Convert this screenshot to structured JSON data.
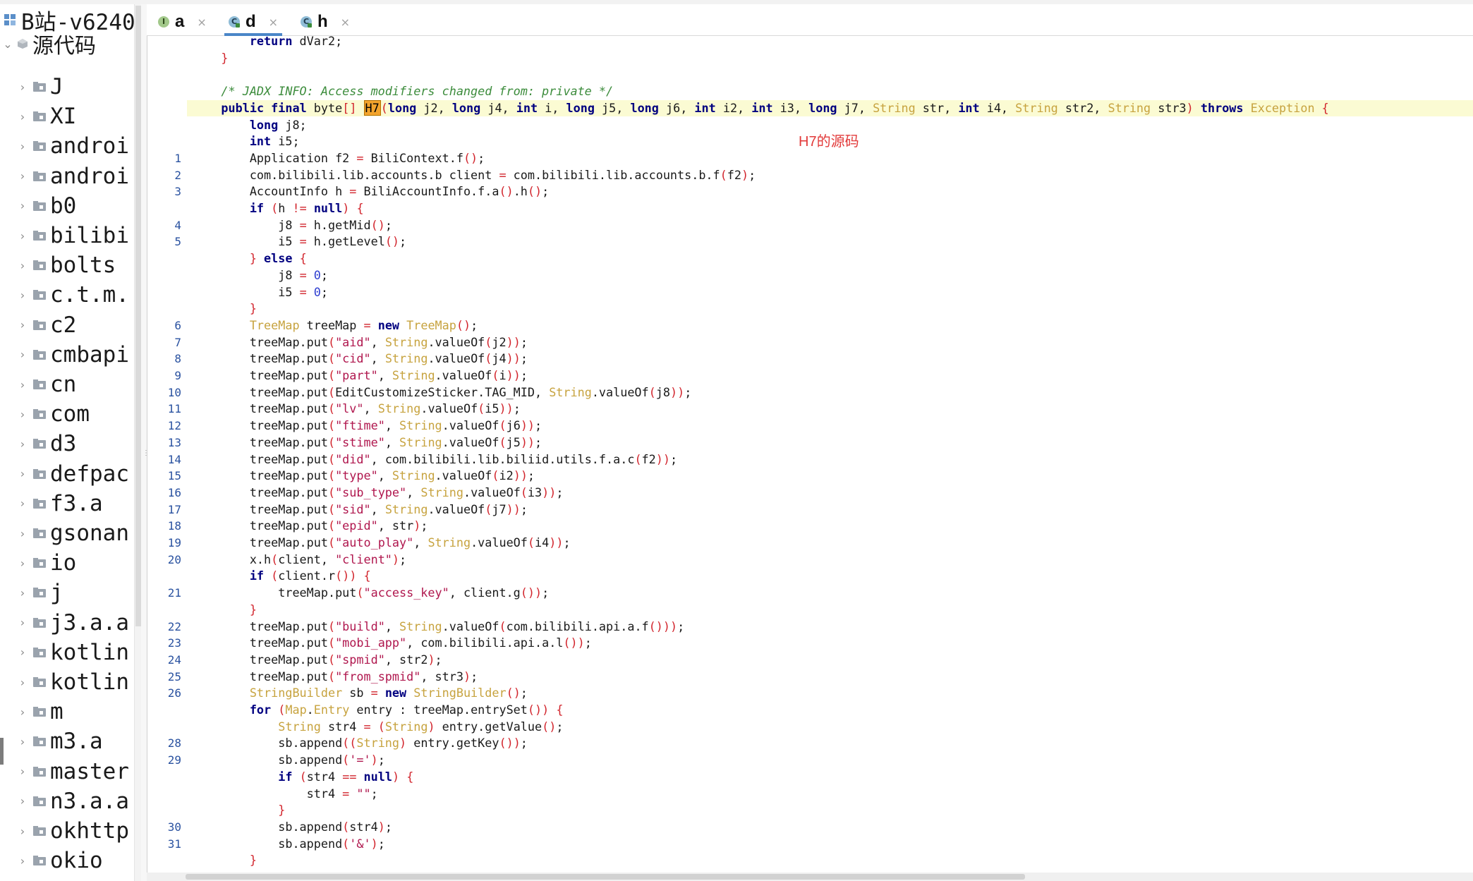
{
  "project": {
    "title": "B站-v6240",
    "root_label": "源代码"
  },
  "tree_items": [
    "J",
    "XI",
    "androi",
    "androi",
    "b0",
    "bilibi",
    "bolts",
    "c.t.m.",
    "c2",
    "cmbapi",
    "cn",
    "com",
    "d3",
    "defpac",
    "f3.a",
    "gsonan",
    "io",
    "j",
    "j3.a.a",
    "kotlin",
    "kotlin",
    "m",
    "m3.a",
    "master",
    "n3.a.a",
    "okhttp",
    "okio"
  ],
  "tabs": [
    {
      "name": "a",
      "icon": "I",
      "kind": "interface",
      "close": "×"
    },
    {
      "name": "d",
      "icon": "C",
      "kind": "class",
      "close": "×",
      "active": true
    },
    {
      "name": "h",
      "icon": "C",
      "kind": "class",
      "close": "×"
    }
  ],
  "annotation": "H7的源码",
  "editor": {
    "line_numbers": [
      "",
      "",
      "",
      "",
      "",
      "",
      "",
      "1",
      "2",
      "3",
      "",
      "4",
      "5",
      "",
      "",
      "",
      "",
      "6",
      "7",
      "8",
      "9",
      "10",
      "11",
      "12",
      "13",
      "14",
      "15",
      "16",
      "17",
      "18",
      "19",
      "20",
      "",
      "21",
      "",
      "22",
      "23",
      "24",
      "25",
      "26",
      "",
      "",
      "28",
      "29",
      "",
      "",
      "",
      "30",
      "31",
      ""
    ],
    "code_lines": [
      "        return dVar2;",
      "    }",
      "",
      "    /* JADX INFO: Access modifiers changed from: private */",
      "    public final byte[] H7(long j2, long j4, int i, long j5, long j6, int i2, int i3, long j7, String str, int i4, String str2, String str3) throws Exception {",
      "        long j8;",
      "        int i5;",
      "        Application f2 = BiliContext.f();",
      "        com.bilibili.lib.accounts.b client = com.bilibili.lib.accounts.b.f(f2);",
      "        AccountInfo h = BiliAccountInfo.f.a().h();",
      "        if (h != null) {",
      "            j8 = h.getMid();",
      "            i5 = h.getLevel();",
      "        } else {",
      "            j8 = 0;",
      "            i5 = 0;",
      "        }",
      "        TreeMap treeMap = new TreeMap();",
      "        treeMap.put(\"aid\", String.valueOf(j2));",
      "        treeMap.put(\"cid\", String.valueOf(j4));",
      "        treeMap.put(\"part\", String.valueOf(i));",
      "        treeMap.put(EditCustomizeSticker.TAG_MID, String.valueOf(j8));",
      "        treeMap.put(\"lv\", String.valueOf(i5));",
      "        treeMap.put(\"ftime\", String.valueOf(j6));",
      "        treeMap.put(\"stime\", String.valueOf(j5));",
      "        treeMap.put(\"did\", com.bilibili.lib.biliid.utils.f.a.c(f2));",
      "        treeMap.put(\"type\", String.valueOf(i2));",
      "        treeMap.put(\"sub_type\", String.valueOf(i3));",
      "        treeMap.put(\"sid\", String.valueOf(j7));",
      "        treeMap.put(\"epid\", str);",
      "        treeMap.put(\"auto_play\", String.valueOf(i4));",
      "        x.h(client, \"client\");",
      "        if (client.r()) {",
      "            treeMap.put(\"access_key\", client.g());",
      "        }",
      "        treeMap.put(\"build\", String.valueOf(com.bilibili.api.a.f()));",
      "        treeMap.put(\"mobi_app\", com.bilibili.api.a.l());",
      "        treeMap.put(\"spmid\", str2);",
      "        treeMap.put(\"from_spmid\", str3);",
      "        StringBuilder sb = new StringBuilder();",
      "        for (Map.Entry entry : treeMap.entrySet()) {",
      "            String str4 = (String) entry.getValue();",
      "            sb.append((String) entry.getKey());",
      "            sb.append('=');",
      "            if (str4 == null) {",
      "                str4 = \"\";",
      "            }",
      "            sb.append(str4);",
      "            sb.append('&');",
      "        }"
    ]
  },
  "colors": {
    "keyword": "#000080",
    "type": "#c7a33f",
    "string": "#b0174e",
    "number": "#2f3fd0",
    "comment": "#3c8c3c",
    "brace": "#d2262e",
    "highlight_line": "#fbfbd3",
    "annotation": "#e23a3a",
    "line_number": "#2a52a0"
  }
}
